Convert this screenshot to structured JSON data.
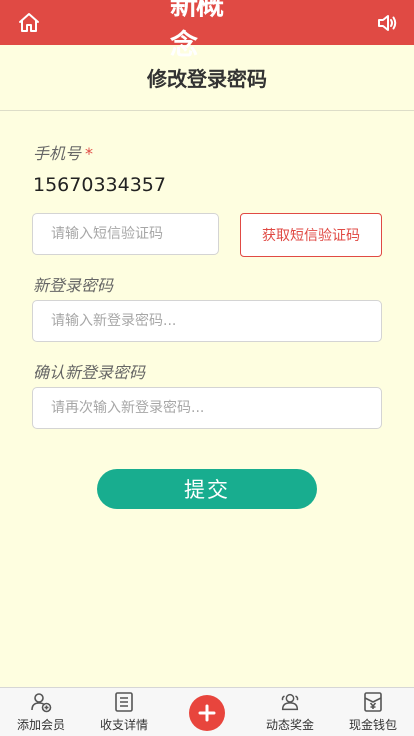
{
  "header": {
    "logo_text": "新概念",
    "home_icon": "home-icon",
    "sound_icon": "speaker-icon",
    "bg_color": "#e04a44"
  },
  "page": {
    "title": "修改登录密码"
  },
  "form": {
    "phone_label": "手机号",
    "required_mark": "*",
    "phone_value": "15670334357",
    "sms_placeholder": "请输入短信验证码",
    "sms_button": "获取短信验证码",
    "new_password_label": "新登录密码",
    "new_password_placeholder": "请输入新登录密码...",
    "confirm_password_label": "确认新登录密码",
    "confirm_password_placeholder": "请再次输入新登录密码...",
    "submit_label": "提交",
    "accent_color": "#18ad8f"
  },
  "tabbar": {
    "items": [
      {
        "label": "添加会员",
        "icon": "add-member-icon"
      },
      {
        "label": "收支详情",
        "icon": "list-icon"
      },
      {
        "label": "动态奖金",
        "icon": "users-icon"
      },
      {
        "label": "现金钱包",
        "icon": "wallet-icon"
      }
    ],
    "center_icon": "plus-icon",
    "center_color": "#e8453d"
  }
}
